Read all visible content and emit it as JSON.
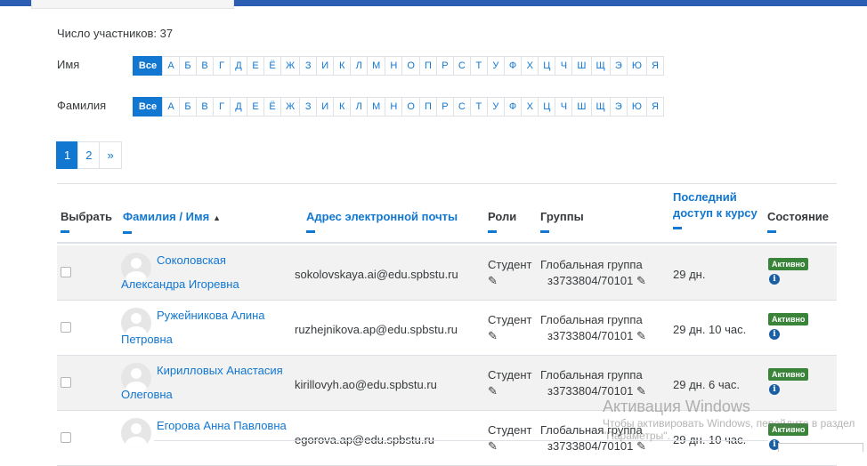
{
  "participants_count_label": "Число участников: 37",
  "filters": {
    "first_name_label": "Имя",
    "last_name_label": "Фамилия",
    "letters": [
      "Все",
      "А",
      "Б",
      "В",
      "Г",
      "Д",
      "Е",
      "Ё",
      "Ж",
      "З",
      "И",
      "К",
      "Л",
      "М",
      "Н",
      "О",
      "П",
      "Р",
      "С",
      "Т",
      "У",
      "Ф",
      "Х",
      "Ц",
      "Ч",
      "Ш",
      "Щ",
      "Э",
      "Ю",
      "Я"
    ],
    "active_letter": "Все"
  },
  "pagination": {
    "pages": [
      "1",
      "2",
      "»"
    ],
    "active_page": "1"
  },
  "table": {
    "headers": {
      "select": "Выбрать",
      "name": "Фамилия / Имя",
      "email": "Адрес электронной почты",
      "roles": "Роли",
      "groups": "Группы",
      "last_access_line1": "Последний",
      "last_access_line2": "доступ к курсу",
      "status": "Состояние"
    },
    "rows": [
      {
        "name_line1": "Соколовская",
        "name_line2": "Александра Игоревна",
        "email": "sokolovskaya.ai@edu.spbstu.ru",
        "role": "Студент",
        "group_line1": "Глобальная группа",
        "group_line2": "з3733804/70101",
        "last_access": "29 дн.",
        "status": "Активно"
      },
      {
        "name_line1": "Ружейникова Алина",
        "name_line2": "Петровна",
        "email": "ruzhejnikova.ap@edu.spbstu.ru",
        "role": "Студент",
        "group_line1": "Глобальная группа",
        "group_line2": "з3733804/70101",
        "last_access": "29 дн. 10 час.",
        "status": "Активно"
      },
      {
        "name_line1": "Кирилловых Анастасия",
        "name_line2": "Олеговна",
        "email": "kirillovyh.ao@edu.spbstu.ru",
        "role": "Студент",
        "group_line1": "Глобальная группа",
        "group_line2": "з3733804/70101",
        "last_access": "29 дн. 6 час.",
        "status": "Активно"
      },
      {
        "name_line1": "Егорова Анна Павловна",
        "name_line2": "",
        "email": "egorova.ap@edu.spbstu.ru",
        "role": "Студент",
        "group_line1": "Глобальная группа",
        "group_line2": "з3733804/70101",
        "last_access": "29 дн. 10 час.",
        "status": "Активно"
      }
    ]
  },
  "watermark": {
    "title": "Активация Windows",
    "line": "Чтобы активировать Windows, перейдите в раздел \"Параметры\"."
  },
  "colors": {
    "accent": "#1177d1",
    "topbar": "#2c5fb3",
    "success": "#398439"
  }
}
